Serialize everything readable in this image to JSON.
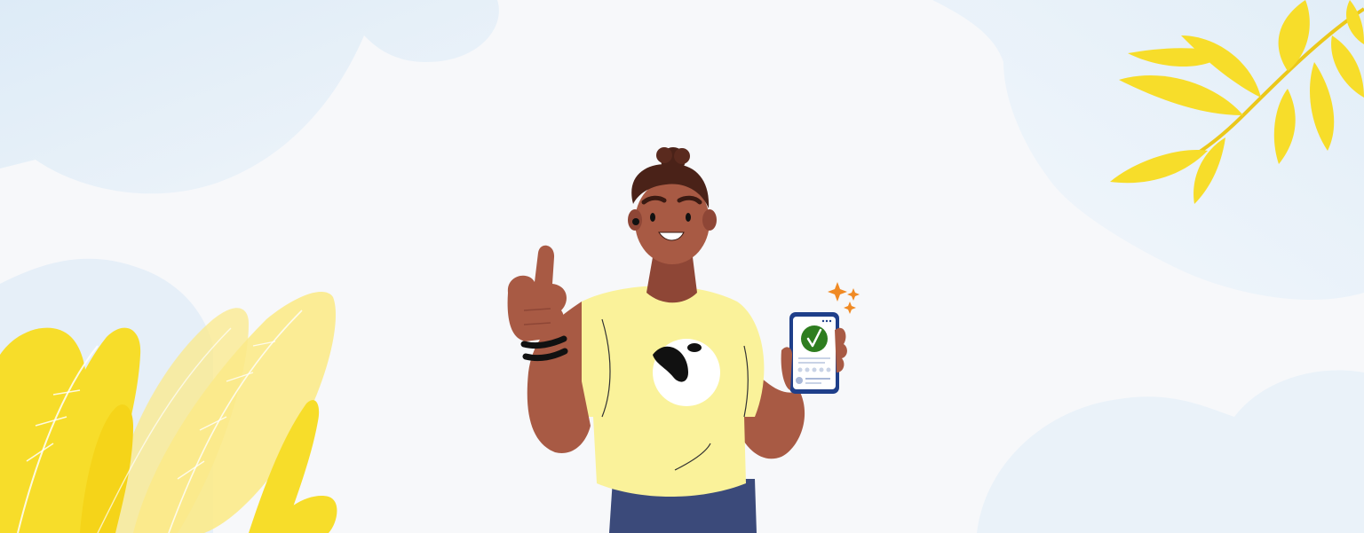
{
  "scene": {
    "description_free": true,
    "palette": {
      "background": "#F7F8FA",
      "cloud": "#E9F2FA",
      "skin": "#A85A44",
      "skin_dark": "#8E4636",
      "hair": "#4A2218",
      "shirt": "#FAF29A",
      "pants": "#3B4A7A",
      "logo_white": "#FFFFFF",
      "logo_black": "#111111",
      "phone_frame": "#1F3F8A",
      "check_green": "#2E7D1F",
      "sparkle": "#F08A24",
      "leaf_yellow": "#F7DD2A",
      "leaf_light": "#FBEA8A",
      "wristband": "#111111"
    },
    "icons": {
      "phone": "phone-icon",
      "check": "check-icon",
      "sparkles": "sparkle-icon"
    }
  }
}
